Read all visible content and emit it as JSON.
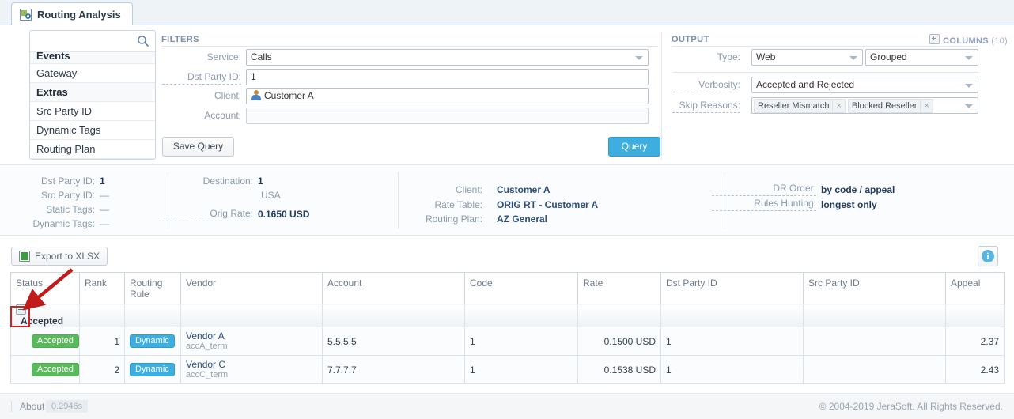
{
  "tab": {
    "label": "Routing Analysis",
    "icon": "routing-analysis-icon"
  },
  "sidebar": {
    "search_placeholder": "",
    "search_value": "",
    "search_icon": "search-icon",
    "items": [
      {
        "label": "Events",
        "type": "group",
        "clipped": true
      },
      {
        "label": "Gateway",
        "type": "item"
      },
      {
        "label": "Extras",
        "type": "group"
      },
      {
        "label": "Src Party ID",
        "type": "item"
      },
      {
        "label": "Dynamic Tags",
        "type": "item"
      },
      {
        "label": "Routing Plan",
        "type": "item"
      }
    ]
  },
  "filters": {
    "title": "FILTERS",
    "service_label": "Service:",
    "service_value": "Calls",
    "dst_party_label": "Dst Party ID:",
    "dst_party_value": "1",
    "client_label": "Client:",
    "client_value": "Customer A",
    "client_icon": "user-icon",
    "account_label": "Account:",
    "account_value": "",
    "save_query_label": "Save Query",
    "query_label": "Query"
  },
  "output": {
    "title": "OUTPUT",
    "columns_label": "COLUMNS",
    "columns_count": "(10)",
    "columns_icon": "expand-box-icon",
    "type_label": "Type:",
    "type_value": "Web",
    "format_value": "Grouped",
    "verbosity_label": "Verbosity:",
    "verbosity_value": "Accepted and Rejected",
    "skip_reasons_label": "Skip Reasons:",
    "skip_reasons": [
      "Reseller Mismatch",
      "Blocked Reseller"
    ]
  },
  "summary": {
    "col1": [
      {
        "label": "Dst Party ID:",
        "value": "1",
        "dashed": false
      },
      {
        "label": "Src Party ID:",
        "value": "—",
        "dashed": false
      },
      {
        "label": "Static Tags:",
        "value": "—",
        "dashed": false
      },
      {
        "label": "Dynamic Tags:",
        "value": "—",
        "dashed": false
      }
    ],
    "col2": [
      {
        "label": "Destination:",
        "value": "1",
        "dashed": false
      },
      {
        "label": "",
        "value": "USA",
        "dashed": false,
        "plain": true
      },
      {
        "label": "Orig Rate:",
        "value": "0.1650 USD",
        "dashed": true
      }
    ],
    "col3": [
      {
        "label": "Client:",
        "value": "Customer A",
        "dashed": false
      },
      {
        "label": "Rate Table:",
        "value": "ORIG RT - Customer A",
        "dashed": false
      },
      {
        "label": "Routing Plan:",
        "value": "AZ General",
        "dashed": false
      }
    ],
    "col4": [
      {
        "label": "DR Order:",
        "value": "by code / appeal",
        "dashed": true
      },
      {
        "label": "Rules Hunting:",
        "value": "longest only",
        "dashed": true
      }
    ]
  },
  "toolbar": {
    "export_label": "Export to XLSX",
    "export_icon": "xlsx-icon",
    "info_icon": "info-icon"
  },
  "table": {
    "columns": [
      {
        "label": "Status",
        "dashed": false,
        "align": "left"
      },
      {
        "label": "Rank",
        "dashed": false,
        "align": "left"
      },
      {
        "label": "Routing Rule",
        "dashed": false,
        "align": "left"
      },
      {
        "label": "Vendor",
        "dashed": false,
        "align": "left"
      },
      {
        "label": "Account",
        "dashed": true,
        "align": "left"
      },
      {
        "label": "Code",
        "dashed": false,
        "align": "left"
      },
      {
        "label": "Rate",
        "dashed": true,
        "align": "left"
      },
      {
        "label": "Dst Party ID",
        "dashed": true,
        "align": "left"
      },
      {
        "label": "Src Party ID",
        "dashed": true,
        "align": "left"
      },
      {
        "label": "Appeal",
        "dashed": true,
        "align": "left"
      }
    ],
    "group_row": {
      "label": "Accepted",
      "collapse_icon": "collapse-minus-icon"
    },
    "rows": [
      {
        "status": "Accepted",
        "rank": "1",
        "routing_rule": "Dynamic",
        "vendor": "Vendor A",
        "vendor_sub": "accA_term",
        "account": "5.5.5.5",
        "code": "1",
        "rate": "0.1500 USD",
        "dst_party_id": "1",
        "src_party_id": "",
        "appeal": "2.37"
      },
      {
        "status": "Accepted",
        "rank": "2",
        "routing_rule": "Dynamic",
        "vendor": "Vendor C",
        "vendor_sub": "accC_term",
        "account": "7.7.7.7",
        "code": "1",
        "rate": "0.1538 USD",
        "dst_party_id": "1",
        "src_party_id": "",
        "appeal": "2.43"
      }
    ]
  },
  "footer": {
    "about_label": "About",
    "time_label": "0.2946s",
    "copyright": "© 2004-2019 JeraSoft. All Rights Reserved."
  },
  "colors": {
    "accent_blue": "#3eaee0",
    "badge_green": "#5cb85c",
    "annotation_red": "#d02020",
    "link_blue": "#2c4f7c"
  }
}
